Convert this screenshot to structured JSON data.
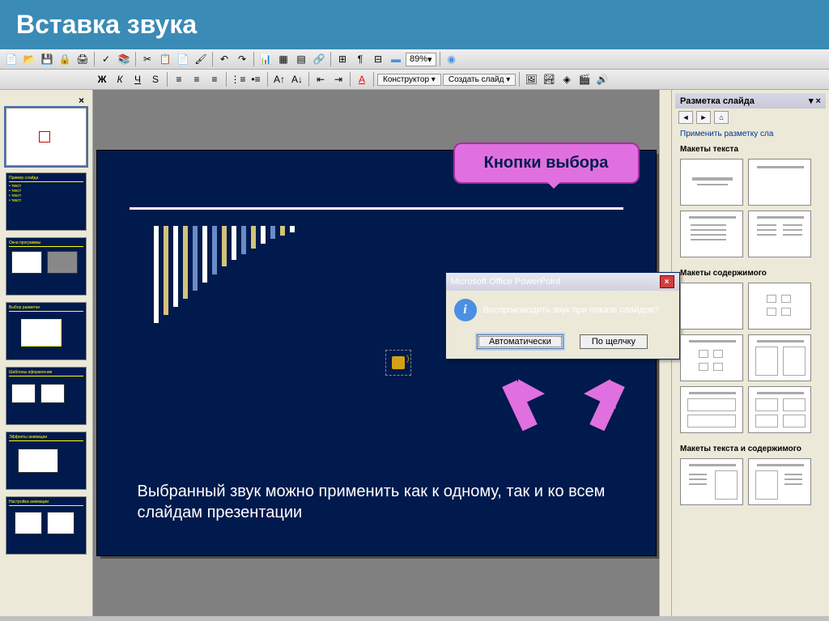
{
  "page_title": "Вставка звука",
  "toolbar": {
    "zoom": "89%",
    "designer_label": "Конструктор",
    "newslide_label": "Создать слайд"
  },
  "thumbs_close": "×",
  "callout_text": "Кнопки выбора",
  "dialog": {
    "title": "Microsoft Office PowerPoint",
    "message": "Воспроизводить звук при показе слайдов?",
    "btn_auto": "Автоматически",
    "btn_click": "По щелчку"
  },
  "slide_text": "Выбранный звук можно применить как к одному, так и ко всем слайдам презентации",
  "task_pane": {
    "title": "Разметка слайда",
    "apply_link": "Применить разметку сла",
    "section_text": "Макеты текста",
    "section_content": "Макеты содержимого",
    "section_mixed": "Макеты текста и содержимого"
  }
}
